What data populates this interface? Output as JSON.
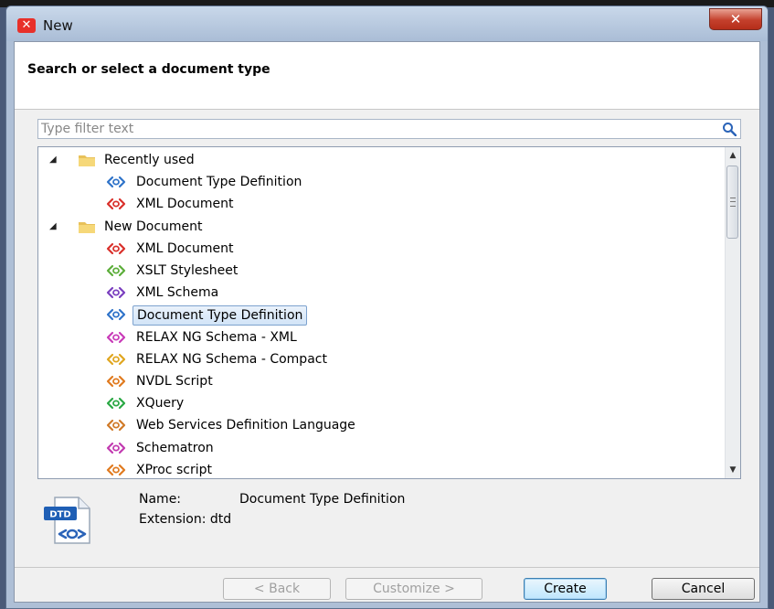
{
  "window": {
    "title": "New",
    "close_glyph": "✕"
  },
  "header": {
    "title": "Search or select a document type"
  },
  "filter": {
    "placeholder": "Type filter text",
    "value": ""
  },
  "tree": {
    "rows": [
      {
        "kind": "group",
        "label": "Recently used",
        "expanded": true
      },
      {
        "kind": "item",
        "label": "Document Type Definition",
        "icon": "dtd-file-icon",
        "color": "#2f73c9"
      },
      {
        "kind": "item",
        "label": "XML Document",
        "icon": "xml-file-icon",
        "color": "#d9302b"
      },
      {
        "kind": "group",
        "label": "New Document",
        "expanded": true
      },
      {
        "kind": "item",
        "label": "XML Document",
        "icon": "xml-file-icon",
        "color": "#d9302b"
      },
      {
        "kind": "item",
        "label": "XSLT Stylesheet",
        "icon": "xslt-file-icon",
        "color": "#5cae3a"
      },
      {
        "kind": "item",
        "label": "XML Schema",
        "icon": "xml-schema-file-icon",
        "color": "#7a3fbf"
      },
      {
        "kind": "item",
        "label": "Document Type Definition",
        "icon": "dtd-file-icon",
        "color": "#2f73c9",
        "selected": true
      },
      {
        "kind": "item",
        "label": "RELAX NG Schema - XML",
        "icon": "relax-ng-xml-file-icon",
        "color": "#c93bb8"
      },
      {
        "kind": "item",
        "label": "RELAX NG Schema - Compact",
        "icon": "relax-ng-compact-file-icon",
        "color": "#e0a61f"
      },
      {
        "kind": "item",
        "label": "NVDL Script",
        "icon": "nvdl-file-icon",
        "color": "#e07a1f"
      },
      {
        "kind": "item",
        "label": "XQuery",
        "icon": "xquery-file-icon",
        "color": "#2aa844"
      },
      {
        "kind": "item",
        "label": "Web Services Definition Language",
        "icon": "wsdl-file-icon",
        "color": "#d07a28"
      },
      {
        "kind": "item",
        "label": "Schematron",
        "icon": "schematron-file-icon",
        "color": "#c23ab0"
      },
      {
        "kind": "item",
        "label": "XProc script",
        "icon": "xproc-file-icon",
        "color": "#e07a1f"
      }
    ]
  },
  "info": {
    "badge": "DTD",
    "name_label": "Name:",
    "name_value": "Document Type Definition",
    "extension_text": "Extension: dtd"
  },
  "buttons": {
    "back": "< Back",
    "customize": "Customize >",
    "create": "Create",
    "cancel": "Cancel"
  },
  "colors": {
    "accent": "#2f73c9",
    "selection": "#d2e4f7",
    "close": "#c4402c"
  }
}
